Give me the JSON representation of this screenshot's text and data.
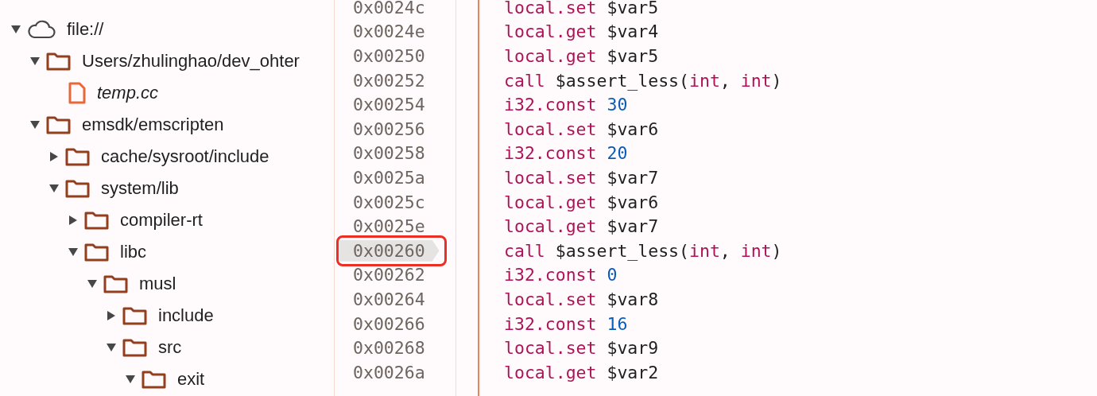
{
  "tree": [
    {
      "label": "file://",
      "kind": "domain",
      "selected": false,
      "italic": false,
      "expanded": true,
      "children": [
        {
          "label": "Users/zhulinghao/dev_ohter",
          "kind": "folder",
          "selected": false,
          "italic": false,
          "expanded": true,
          "children": [
            {
              "label": "temp.cc",
              "kind": "file",
              "selected": false,
              "italic": true
            }
          ]
        },
        {
          "label": "emsdk/emscripten",
          "kind": "folder",
          "selected": false,
          "italic": false,
          "expanded": true,
          "children": [
            {
              "label": "cache/sysroot/include",
              "kind": "folder",
              "selected": false,
              "italic": false,
              "expanded": false
            },
            {
              "label": "system/lib",
              "kind": "folder",
              "selected": false,
              "italic": false,
              "expanded": true,
              "children": [
                {
                  "label": "compiler-rt",
                  "kind": "folder",
                  "selected": false,
                  "italic": false,
                  "expanded": false
                },
                {
                  "label": "libc",
                  "kind": "folder",
                  "selected": false,
                  "italic": false,
                  "expanded": true,
                  "children": [
                    {
                      "label": "musl",
                      "kind": "folder",
                      "selected": false,
                      "italic": false,
                      "expanded": true,
                      "children": [
                        {
                          "label": "include",
                          "kind": "folder",
                          "selected": false,
                          "italic": false,
                          "expanded": false
                        },
                        {
                          "label": "src",
                          "kind": "folder",
                          "selected": false,
                          "italic": false,
                          "expanded": true,
                          "children": [
                            {
                              "label": "exit",
                              "kind": "folder",
                              "selected": false,
                              "italic": false,
                              "expanded": true
                            }
                          ]
                        }
                      ]
                    }
                  ]
                }
              ]
            }
          ]
        }
      ]
    }
  ],
  "disassembly": {
    "rows": [
      {
        "address": "0x0024c",
        "selected": false,
        "annotated": false,
        "code": [
          {
            "kind": "keyword",
            "text": "local.set"
          },
          {
            "kind": "plain",
            "text": " $var5"
          }
        ]
      },
      {
        "address": "0x0024e",
        "selected": false,
        "annotated": false,
        "code": [
          {
            "kind": "keyword",
            "text": "local.get"
          },
          {
            "kind": "plain",
            "text": " $var4"
          }
        ]
      },
      {
        "address": "0x00250",
        "selected": false,
        "annotated": false,
        "code": [
          {
            "kind": "keyword",
            "text": "local.get"
          },
          {
            "kind": "plain",
            "text": " $var5"
          }
        ]
      },
      {
        "address": "0x00252",
        "selected": false,
        "annotated": false,
        "code": [
          {
            "kind": "keyword",
            "text": "call"
          },
          {
            "kind": "plain",
            "text": " $assert_less("
          },
          {
            "kind": "keyword",
            "text": "int"
          },
          {
            "kind": "plain",
            "text": ", "
          },
          {
            "kind": "keyword",
            "text": "int"
          },
          {
            "kind": "plain",
            "text": ")"
          }
        ]
      },
      {
        "address": "0x00254",
        "selected": false,
        "annotated": false,
        "code": [
          {
            "kind": "keyword",
            "text": "i32.const "
          },
          {
            "kind": "number",
            "text": "30"
          }
        ]
      },
      {
        "address": "0x00256",
        "selected": false,
        "annotated": false,
        "code": [
          {
            "kind": "keyword",
            "text": "local.set"
          },
          {
            "kind": "plain",
            "text": " $var6"
          }
        ]
      },
      {
        "address": "0x00258",
        "selected": false,
        "annotated": false,
        "code": [
          {
            "kind": "keyword",
            "text": "i32.const "
          },
          {
            "kind": "number",
            "text": "20"
          }
        ]
      },
      {
        "address": "0x0025a",
        "selected": false,
        "annotated": false,
        "code": [
          {
            "kind": "keyword",
            "text": "local.set"
          },
          {
            "kind": "plain",
            "text": " $var7"
          }
        ]
      },
      {
        "address": "0x0025c",
        "selected": false,
        "annotated": false,
        "code": [
          {
            "kind": "keyword",
            "text": "local.get"
          },
          {
            "kind": "plain",
            "text": " $var6"
          }
        ]
      },
      {
        "address": "0x0025e",
        "selected": false,
        "annotated": false,
        "code": [
          {
            "kind": "keyword",
            "text": "local.get"
          },
          {
            "kind": "plain",
            "text": " $var7"
          }
        ]
      },
      {
        "address": "0x00260",
        "selected": true,
        "annotated": true,
        "code": [
          {
            "kind": "keyword",
            "text": "call"
          },
          {
            "kind": "plain",
            "text": " $assert_less("
          },
          {
            "kind": "keyword",
            "text": "int"
          },
          {
            "kind": "plain",
            "text": ", "
          },
          {
            "kind": "keyword",
            "text": "int"
          },
          {
            "kind": "plain",
            "text": ")"
          }
        ]
      },
      {
        "address": "0x00262",
        "selected": false,
        "annotated": false,
        "code": [
          {
            "kind": "keyword",
            "text": "i32.const "
          },
          {
            "kind": "number",
            "text": "0"
          }
        ]
      },
      {
        "address": "0x00264",
        "selected": false,
        "annotated": false,
        "code": [
          {
            "kind": "keyword",
            "text": "local.set"
          },
          {
            "kind": "plain",
            "text": " $var8"
          }
        ]
      },
      {
        "address": "0x00266",
        "selected": false,
        "annotated": false,
        "code": [
          {
            "kind": "keyword",
            "text": "i32.const "
          },
          {
            "kind": "number",
            "text": "16"
          }
        ]
      },
      {
        "address": "0x00268",
        "selected": false,
        "annotated": false,
        "code": [
          {
            "kind": "keyword",
            "text": "local.set"
          },
          {
            "kind": "plain",
            "text": " $var9"
          }
        ]
      },
      {
        "address": "0x0026a",
        "selected": false,
        "annotated": false,
        "code": [
          {
            "kind": "keyword",
            "text": "local.get"
          },
          {
            "kind": "plain",
            "text": " $var2"
          }
        ]
      }
    ]
  }
}
